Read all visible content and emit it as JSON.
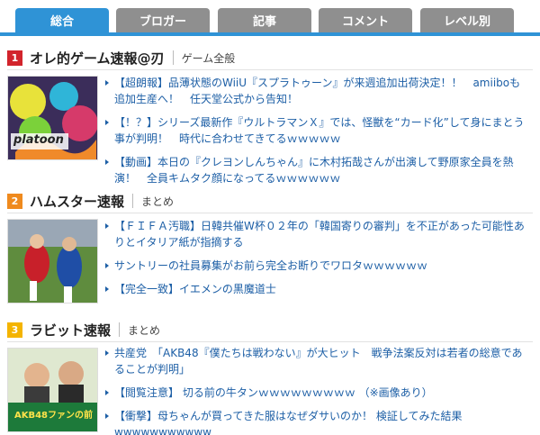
{
  "tabs": [
    {
      "label": "総合",
      "active": true
    },
    {
      "label": "ブロガー",
      "active": false
    },
    {
      "label": "記事",
      "active": false
    },
    {
      "label": "コメント",
      "active": false
    },
    {
      "label": "レベル別",
      "active": false
    }
  ],
  "colors": {
    "accent": "#2f93d6",
    "tab_inactive": "#8f8f8f",
    "rank1": "#d2242c",
    "rank2": "#ef8a1e",
    "rank3": "#f4b400",
    "link": "#1d5fa6"
  },
  "sections": [
    {
      "rank": "1",
      "title": "オレ的ゲーム速報@刃",
      "category": "ゲーム全般",
      "thumb_text": "platoon",
      "links": [
        "【超朗報】品薄状態のWiiU『スプラトゥーン』が来週追加出荷決定！！　amiiboも追加生産へ！　任天堂公式から告知！",
        "【！？】シリーズ最新作『ウルトラマンＸ』では、怪獣を“カード化”して身にまとう事が判明！　時代に合わせてきてるｗｗｗｗｗ",
        "【動画】本日の『クレヨンしんちゃん』に木村拓哉さんが出演して野原家全員を熱演！　全員キムタク顔になってるｗｗｗｗｗｗ"
      ]
    },
    {
      "rank": "2",
      "title": "ハムスター速報",
      "category": "まとめ",
      "links": [
        "【ＦＩＦＡ汚職】日韓共催W杯０２年の「韓国寄りの審判」を不正があった可能性ありとイタリア紙が指摘する",
        "サントリーの社員募集がお前ら完全お断りでワロタｗｗｗｗｗｗ",
        "【完全一致】イエメンの黒魔道士"
      ]
    },
    {
      "rank": "3",
      "title": "ラビット速報",
      "category": "まとめ",
      "thumb_text": "AKB48ファンの前",
      "links": [
        "共産党　「AKB48『僕たちは戦わない』が大ヒット　戦争法案反対は若者の総意であることが判明」",
        "【閲覧注意】 切る前の牛タンｗｗｗｗｗｗｗｗｗ （※画像あり）",
        "【衝撃】母ちゃんが買ってきた服はなぜダサいのか！ 検証してみた結果wwwwwwwwwww"
      ]
    }
  ]
}
